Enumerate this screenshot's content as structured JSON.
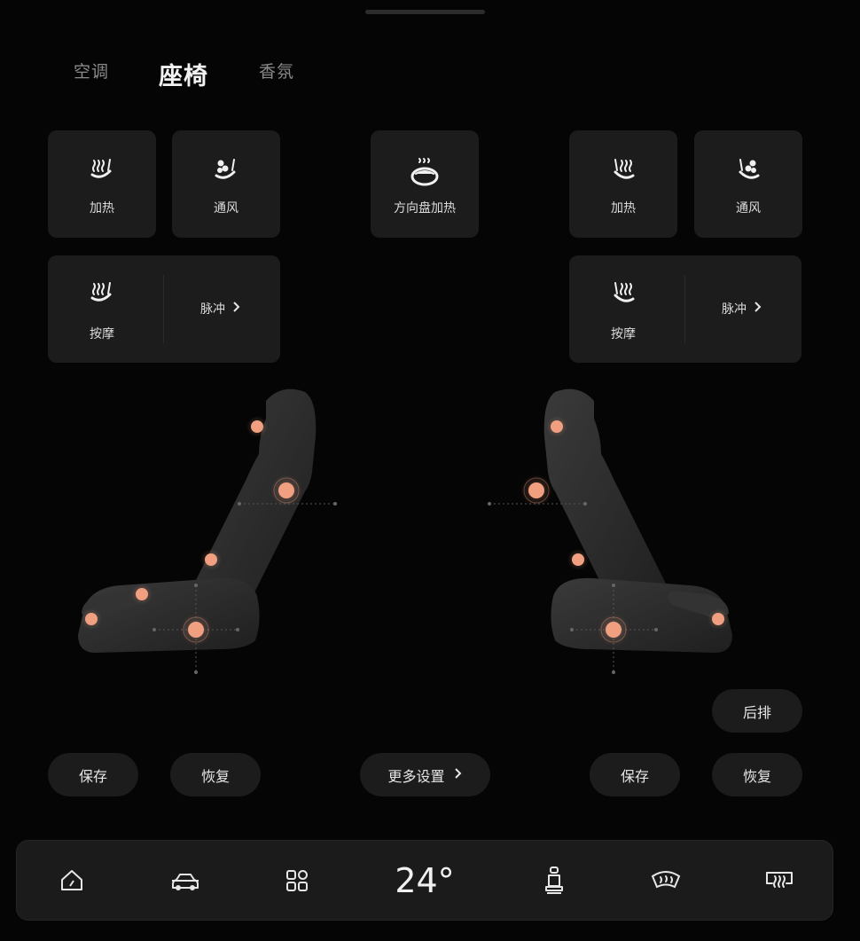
{
  "tabs": [
    {
      "label": "空调",
      "active": false
    },
    {
      "label": "座椅",
      "active": true
    },
    {
      "label": "香氛",
      "active": false
    }
  ],
  "left_seat": {
    "heat_label": "加热",
    "vent_label": "通风",
    "massage_label": "按摩",
    "massage_mode": "脉冲",
    "save_label": "保存",
    "restore_label": "恢复"
  },
  "wheel": {
    "heat_label": "方向盘加热"
  },
  "right_seat": {
    "heat_label": "加热",
    "vent_label": "通风",
    "massage_label": "按摩",
    "massage_mode": "脉冲",
    "rear_label": "后排",
    "save_label": "保存",
    "restore_label": "恢复"
  },
  "more_settings_label": "更多设置",
  "bottom_bar": {
    "temperature": "24°",
    "icons": [
      "home-icon",
      "car-icon",
      "apps-grid-icon",
      "seat-icon",
      "front-defrost-icon",
      "rear-defrost-icon"
    ]
  },
  "colors": {
    "background": "#050505",
    "card": "#1c1c1c",
    "accent_node": "#f0a080",
    "seat": "#2a2a2a"
  }
}
